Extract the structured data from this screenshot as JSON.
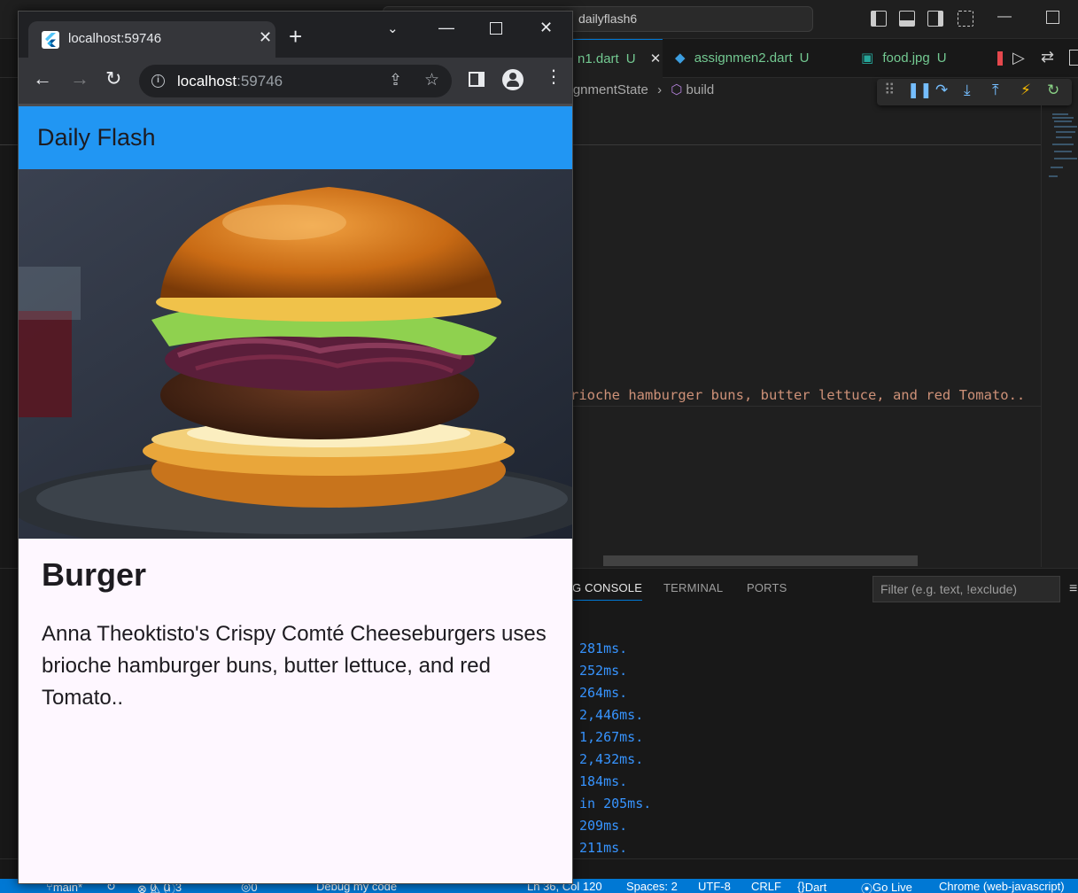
{
  "vscode": {
    "search": "dailyflash6",
    "tabs": [
      {
        "label": "n1.dart",
        "badge": "U"
      },
      {
        "label": "assignmen2.dart",
        "badge": "U"
      },
      {
        "label": "food.jpg",
        "badge": "U"
      }
    ],
    "breadcrumb": {
      "class": "signmentState",
      "method": "build"
    },
    "code_line": "rioche hamburger buns, butter lettuce, and red Tomato..",
    "panel": {
      "tabs": [
        "G CONSOLE",
        "TERMINAL",
        "PORTS"
      ],
      "filter_placeholder": "Filter (e.g. text, !exclude)",
      "logs": [
        "281ms.",
        "252ms.",
        "264ms.",
        "2,446ms.",
        "1,267ms.",
        "2,432ms.",
        "184ms.",
        "in 205ms.",
        "209ms.",
        "211ms."
      ]
    },
    "status": {
      "branch": "main*",
      "problems": "0",
      "warnings": "0",
      "infos": "3",
      "ports": "0",
      "debug": "Debug my code",
      "position": "Ln 36, Col 120",
      "spaces": "Spaces: 2",
      "encoding": "UTF-8",
      "eol": "CRLF",
      "language": "Dart",
      "golive": "Go Live",
      "device": "Chrome (web-javascript)"
    },
    "colors": {
      "accent": "#0078d4",
      "string": "#ce9178",
      "log": "#3794ff"
    }
  },
  "chrome": {
    "tab_title": "localhost:59746",
    "url_host": "localhost",
    "url_port": ":59746"
  },
  "app": {
    "appbar_title": "Daily Flash",
    "appbar_color": "#2196f3",
    "food_name": "Burger",
    "food_description": "Anna Theoktisto's Crispy Comté Cheeseburgers uses brioche hamburger buns, butter lettuce, and red Tomato..",
    "image_subject": "burger-photo"
  }
}
